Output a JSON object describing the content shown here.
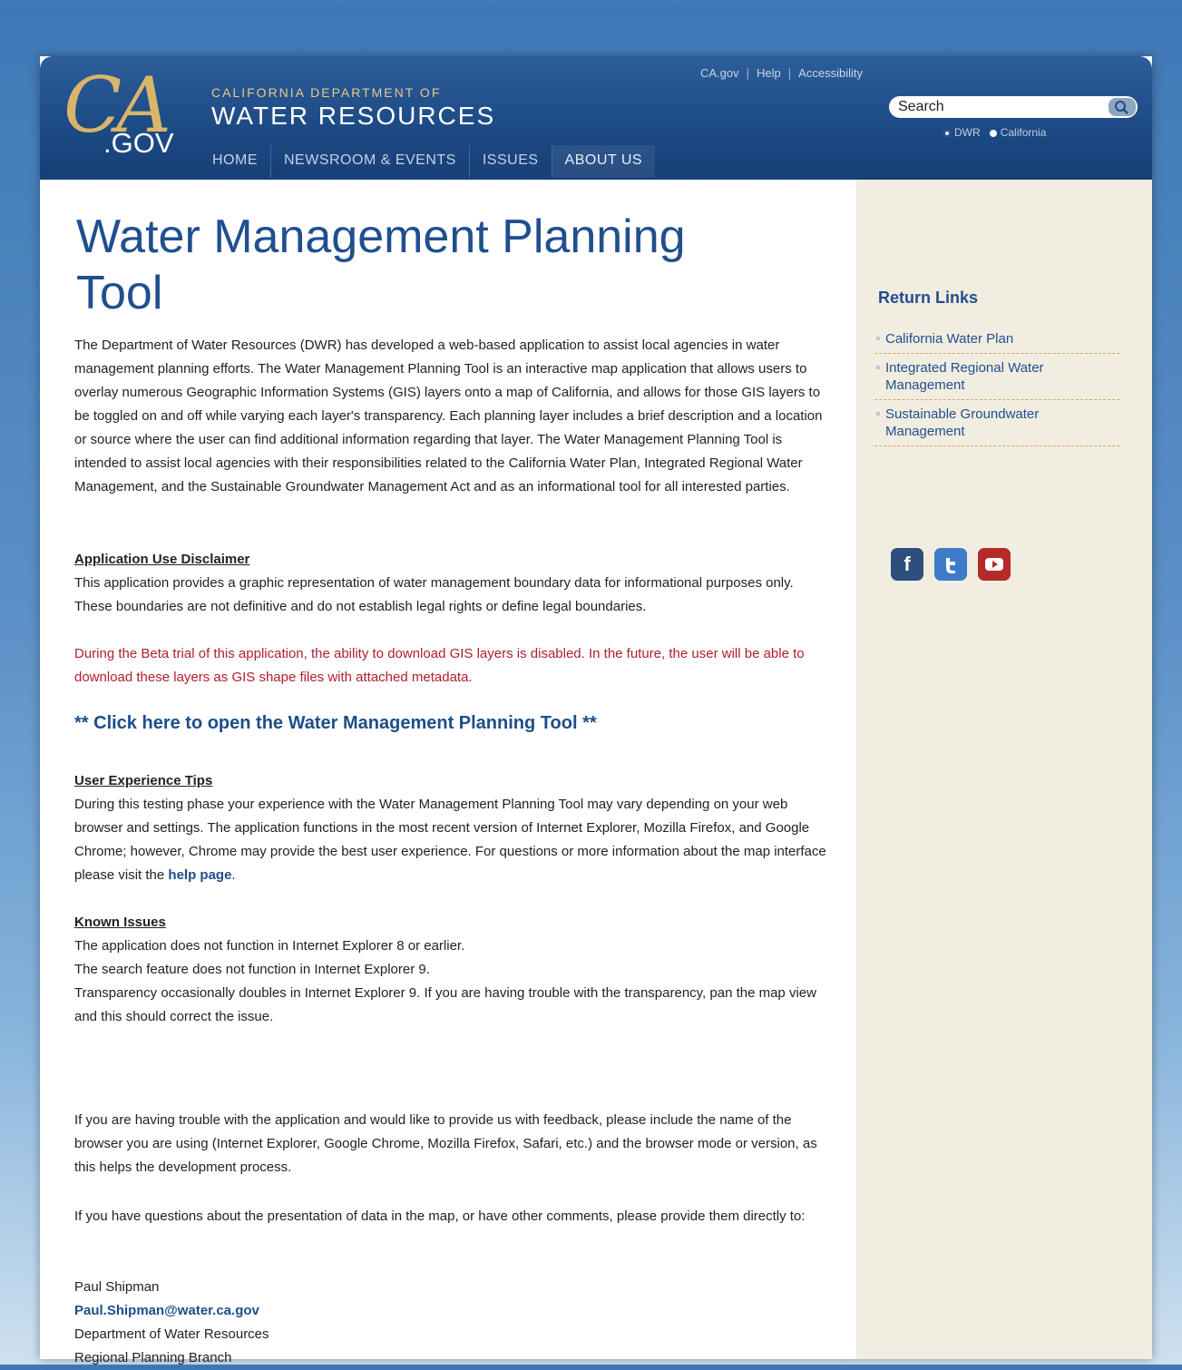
{
  "header": {
    "logo_ca": "CA",
    "logo_gov": ".GOV",
    "dept_small": "CALIFORNIA DEPARTMENT OF",
    "dept_big": "WATER RESOURCES",
    "utility_links": [
      "CA.gov",
      "Help",
      "Accessibility"
    ],
    "search": {
      "value": "",
      "placeholder": "Search",
      "scope_options": [
        "DWR",
        "California"
      ],
      "selected_scope": "DWR"
    },
    "nav": [
      "HOME",
      "NEWSROOM & EVENTS",
      "ISSUES",
      "ABOUT US"
    ],
    "active_nav": "ABOUT US"
  },
  "main": {
    "title": "Water Management Planning Tool",
    "intro": "The Department of Water Resources (DWR) has developed a web-based application to assist local agencies in water management planning efforts. The Water Management Planning Tool is an interactive map application that allows users to overlay numerous Geographic Information Systems (GIS) layers onto a map of California, and allows for those GIS layers to be toggled on and off while varying each layer's transparency. Each planning layer includes a brief description and a location or source where the user can find additional information regarding that layer. The Water Management Planning Tool is intended to assist local agencies with their responsibilities related to the California Water Plan, Integrated Regional Water Management, and the Sustainable Groundwater Management Act and as an informational tool for all interested parties.",
    "disclaimer_heading": "Application Use Disclaimer",
    "disclaimer_text": "This application provides a graphic representation of water management boundary data for informational purposes only. These boundaries are not definitive and do not establish legal rights or define legal boundaries.",
    "beta_notice": "During the Beta trial of this application, the ability to download GIS layers is disabled. In the future, the user will be able to download these layers as GIS shape files with attached metadata.",
    "open_tool_link": "** Click here to open the Water Management Planning Tool **",
    "tips_heading": "User Experience Tips",
    "tips_text": "During this testing phase your experience with the Water Management Planning Tool may vary depending on your web browser and settings. The application functions in the most recent version of Internet Explorer, Mozilla Firefox, and Google Chrome; however, Chrome may provide the best user experience. For questions or more information about the map interface please visit the",
    "help_link": "help page",
    "known_heading": "Known Issues",
    "known_issues": [
      "The application does not function in Internet Explorer 8 or earlier.",
      "The search feature does not function in Internet Explorer 9.",
      "Transparency occasionally doubles in Internet Explorer 9. If you are having trouble with the transparency, pan the map view and this should correct the issue."
    ],
    "feedback": "If you are having trouble with the application and would like to provide us with feedback, please include the name of the browser you are using (Internet Explorer, Google Chrome, Mozilla Firefox, Safari, etc.) and the browser mode or version, as this helps the development process.",
    "questions": "If you have questions about the presentation of data in the map, or have other comments, please provide them directly to:",
    "contact": {
      "name": "Paul Shipman",
      "email": "Paul.Shipman@water.ca.gov",
      "org": "Department of Water Resources",
      "branch": "Regional Planning Branch"
    }
  },
  "sidebar": {
    "title": "Return Links",
    "links": [
      "California Water Plan",
      "Integrated Regional Water Management",
      "Sustainable Groundwater Management"
    ],
    "social_icons": [
      "facebook-icon",
      "twitter-icon",
      "youtube-icon"
    ],
    "colors": {
      "facebook": "#2d4f7d",
      "twitter": "#3d7cc9",
      "youtube": "#b52929"
    }
  },
  "colors": {
    "header_blue": "#1d4b86",
    "title_blue": "#1f4f8f",
    "beta_red": "#b01e2e",
    "sidebar_bg": "#f1ede0"
  }
}
